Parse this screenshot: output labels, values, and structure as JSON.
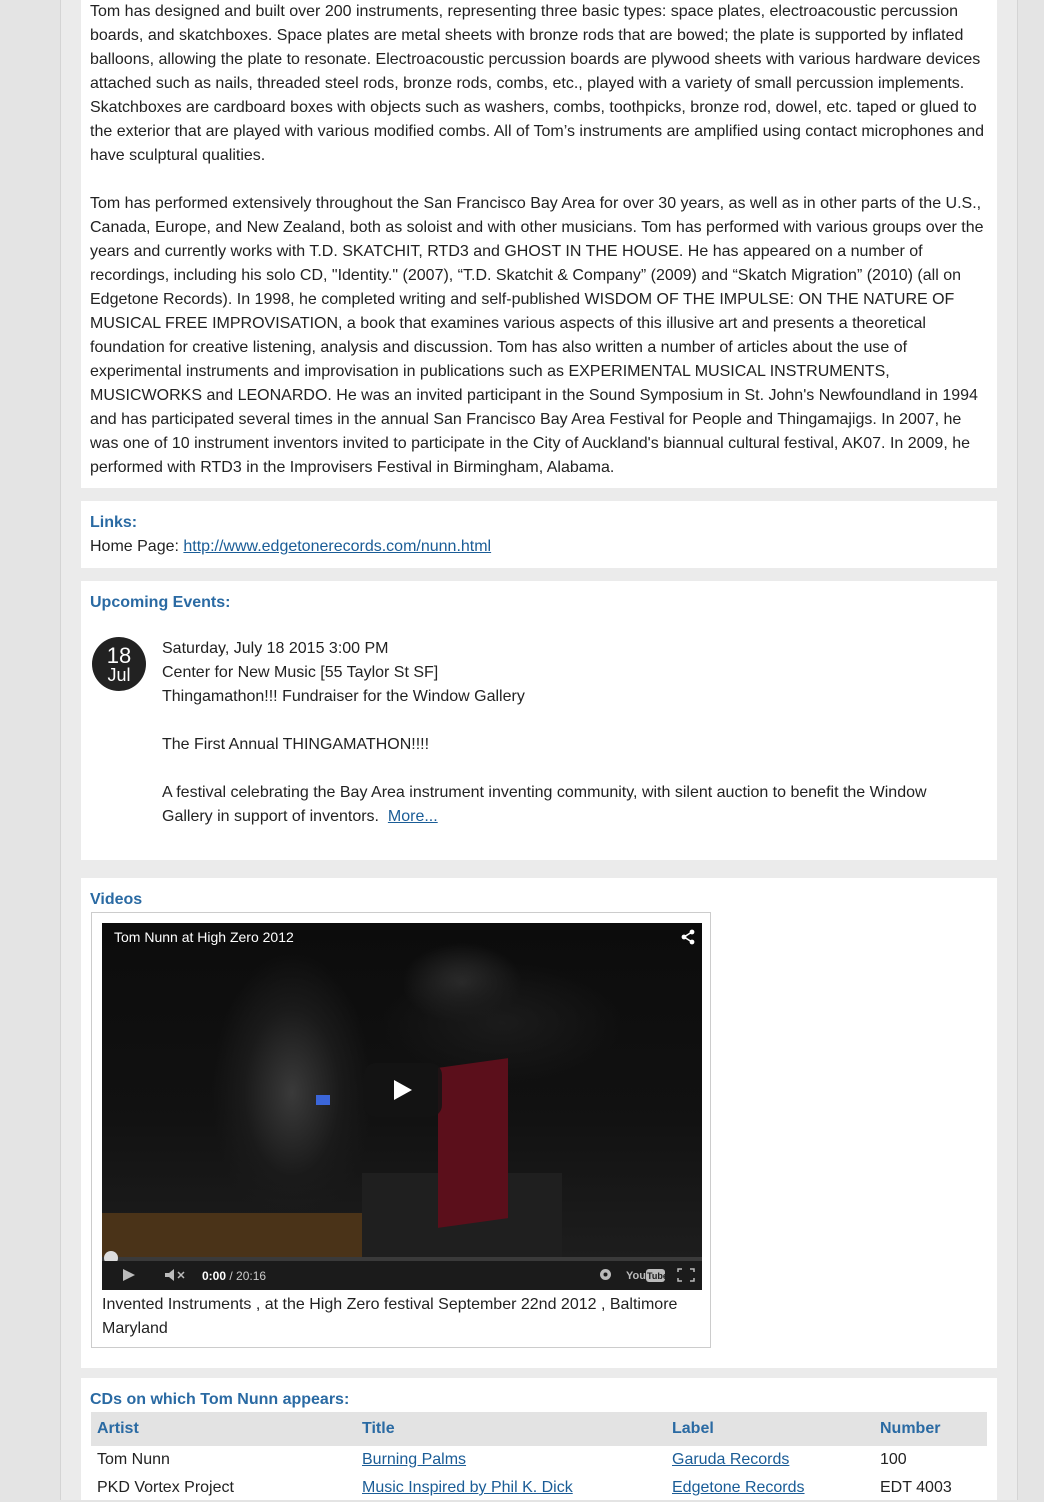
{
  "bio": {
    "p1": "Tom has designed and built over 200 instruments, representing three basic types: space plates, electroacoustic percussion boards, and skatchboxes. Space plates are metal sheets with bronze rods that are bowed; the plate is supported by inflated balloons, allowing the plate to resonate. Electroacoustic percussion boards are plywood sheets with various hardware devices attached such as nails, threaded steel rods, bronze rods, combs, etc., played with a variety of small percussion implements. Skatchboxes are cardboard boxes with objects such as washers, combs, toothpicks, bronze rod, dowel, etc. taped or glued to the exterior that are played with various modified combs. All of Tom’s instruments are amplified using contact microphones and have sculptural qualities.",
    "p2": "Tom has performed extensively throughout the San Francisco Bay Area for over 30 years, as well as in other parts of the U.S., Canada, Europe, and New Zealand, both as soloist and with other musicians. Tom has performed with various groups over the years and currently works with T.D. SKATCHIT, RTD3 and GHOST IN THE HOUSE. He has appeared on a number of recordings, including his solo CD, \"Identity.\" (2007), “T.D. Skatchit & Company” (2009) and “Skatch Migration” (2010) (all on Edgetone Records). In 1998, he completed writing and self-published WISDOM OF THE IMPULSE: ON THE NATURE OF MUSICAL FREE IMPROVISATION, a book that examines various aspects of this illusive art and presents a theoretical foundation for creative listening, analysis and discussion. Tom has also written a number of articles about the use of experimental instruments and improvisation in publications such as EXPERIMENTAL MUSICAL INSTRUMENTS, MUSICWORKS and LEONARDO. He was an invited participant in the Sound Symposium in St. John's Newfoundland in 1994 and has participated several times in the annual San Francisco Bay Area Festival for People and Thingamajigs. In 2007, he was one of 10 instrument inventors invited to participate in the City of Auckland's biannual cultural festival, AK07. In 2009, he performed with RTD3 in the Improvisers Festival in Birmingham, Alabama."
  },
  "links": {
    "heading": "Links:",
    "home_label": "Home Page: ",
    "home_url": "http://www.edgetonerecords.com/nunn.html"
  },
  "events": {
    "heading": "Upcoming Events:",
    "day": "18",
    "month": "Jul",
    "datetime": "Saturday, July 18 2015 3:00 PM",
    "venue": "Center for New Music [55 Taylor St SF]",
    "title": "Thingamathon!!! Fundraiser for the Window Gallery",
    "tagline": "The First Annual THINGAMATHON!!!!",
    "description": "A festival celebrating the Bay Area instrument inventing community, with silent auction to benefit the Window Gallery in support of inventors.",
    "more": "More..."
  },
  "videos": {
    "heading": "Videos",
    "video_title": "Tom Nunn at High Zero 2012",
    "time_current": "0:00",
    "time_total": "/ 20:16",
    "caption": "Invented Instruments , at the High Zero festival September 22nd 2012 , Baltimore Maryland",
    "progress": 0
  },
  "cds": {
    "heading": "CDs on which Tom Nunn appears:",
    "columns": [
      "Artist",
      "Title",
      "Label",
      "Number"
    ],
    "rows": [
      [
        "Tom Nunn",
        "Burning Palms",
        "Garuda Records",
        "100"
      ],
      [
        "PKD Vortex Project",
        "Music Inspired by Phil K. Dick",
        "Edgetone Records",
        "EDT 4003"
      ]
    ]
  },
  "icons": [
    "share-icon",
    "play-icon",
    "volume-muted-icon",
    "settings-icon",
    "youtube-logo",
    "fullscreen-icon"
  ]
}
